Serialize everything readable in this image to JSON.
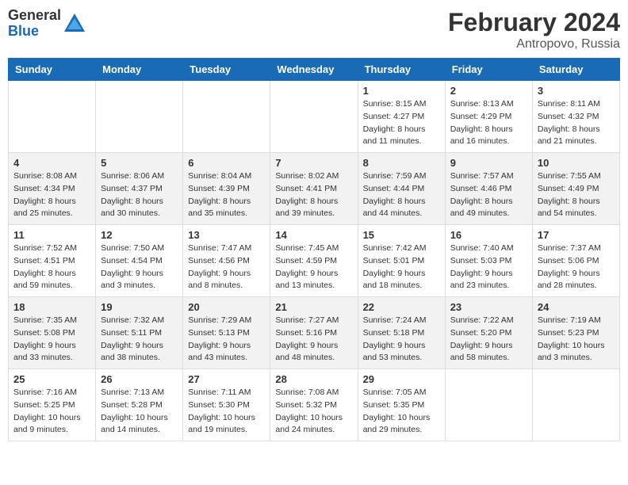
{
  "logo": {
    "general": "General",
    "blue": "Blue"
  },
  "header": {
    "month_year": "February 2024",
    "location": "Antropovo, Russia"
  },
  "days_of_week": [
    "Sunday",
    "Monday",
    "Tuesday",
    "Wednesday",
    "Thursday",
    "Friday",
    "Saturday"
  ],
  "weeks": [
    [
      {
        "day": "",
        "info": ""
      },
      {
        "day": "",
        "info": ""
      },
      {
        "day": "",
        "info": ""
      },
      {
        "day": "",
        "info": ""
      },
      {
        "day": "1",
        "info": "Sunrise: 8:15 AM\nSunset: 4:27 PM\nDaylight: 8 hours and 11 minutes."
      },
      {
        "day": "2",
        "info": "Sunrise: 8:13 AM\nSunset: 4:29 PM\nDaylight: 8 hours and 16 minutes."
      },
      {
        "day": "3",
        "info": "Sunrise: 8:11 AM\nSunset: 4:32 PM\nDaylight: 8 hours and 21 minutes."
      }
    ],
    [
      {
        "day": "4",
        "info": "Sunrise: 8:08 AM\nSunset: 4:34 PM\nDaylight: 8 hours and 25 minutes."
      },
      {
        "day": "5",
        "info": "Sunrise: 8:06 AM\nSunset: 4:37 PM\nDaylight: 8 hours and 30 minutes."
      },
      {
        "day": "6",
        "info": "Sunrise: 8:04 AM\nSunset: 4:39 PM\nDaylight: 8 hours and 35 minutes."
      },
      {
        "day": "7",
        "info": "Sunrise: 8:02 AM\nSunset: 4:41 PM\nDaylight: 8 hours and 39 minutes."
      },
      {
        "day": "8",
        "info": "Sunrise: 7:59 AM\nSunset: 4:44 PM\nDaylight: 8 hours and 44 minutes."
      },
      {
        "day": "9",
        "info": "Sunrise: 7:57 AM\nSunset: 4:46 PM\nDaylight: 8 hours and 49 minutes."
      },
      {
        "day": "10",
        "info": "Sunrise: 7:55 AM\nSunset: 4:49 PM\nDaylight: 8 hours and 54 minutes."
      }
    ],
    [
      {
        "day": "11",
        "info": "Sunrise: 7:52 AM\nSunset: 4:51 PM\nDaylight: 8 hours and 59 minutes."
      },
      {
        "day": "12",
        "info": "Sunrise: 7:50 AM\nSunset: 4:54 PM\nDaylight: 9 hours and 3 minutes."
      },
      {
        "day": "13",
        "info": "Sunrise: 7:47 AM\nSunset: 4:56 PM\nDaylight: 9 hours and 8 minutes."
      },
      {
        "day": "14",
        "info": "Sunrise: 7:45 AM\nSunset: 4:59 PM\nDaylight: 9 hours and 13 minutes."
      },
      {
        "day": "15",
        "info": "Sunrise: 7:42 AM\nSunset: 5:01 PM\nDaylight: 9 hours and 18 minutes."
      },
      {
        "day": "16",
        "info": "Sunrise: 7:40 AM\nSunset: 5:03 PM\nDaylight: 9 hours and 23 minutes."
      },
      {
        "day": "17",
        "info": "Sunrise: 7:37 AM\nSunset: 5:06 PM\nDaylight: 9 hours and 28 minutes."
      }
    ],
    [
      {
        "day": "18",
        "info": "Sunrise: 7:35 AM\nSunset: 5:08 PM\nDaylight: 9 hours and 33 minutes."
      },
      {
        "day": "19",
        "info": "Sunrise: 7:32 AM\nSunset: 5:11 PM\nDaylight: 9 hours and 38 minutes."
      },
      {
        "day": "20",
        "info": "Sunrise: 7:29 AM\nSunset: 5:13 PM\nDaylight: 9 hours and 43 minutes."
      },
      {
        "day": "21",
        "info": "Sunrise: 7:27 AM\nSunset: 5:16 PM\nDaylight: 9 hours and 48 minutes."
      },
      {
        "day": "22",
        "info": "Sunrise: 7:24 AM\nSunset: 5:18 PM\nDaylight: 9 hours and 53 minutes."
      },
      {
        "day": "23",
        "info": "Sunrise: 7:22 AM\nSunset: 5:20 PM\nDaylight: 9 hours and 58 minutes."
      },
      {
        "day": "24",
        "info": "Sunrise: 7:19 AM\nSunset: 5:23 PM\nDaylight: 10 hours and 3 minutes."
      }
    ],
    [
      {
        "day": "25",
        "info": "Sunrise: 7:16 AM\nSunset: 5:25 PM\nDaylight: 10 hours and 9 minutes."
      },
      {
        "day": "26",
        "info": "Sunrise: 7:13 AM\nSunset: 5:28 PM\nDaylight: 10 hours and 14 minutes."
      },
      {
        "day": "27",
        "info": "Sunrise: 7:11 AM\nSunset: 5:30 PM\nDaylight: 10 hours and 19 minutes."
      },
      {
        "day": "28",
        "info": "Sunrise: 7:08 AM\nSunset: 5:32 PM\nDaylight: 10 hours and 24 minutes."
      },
      {
        "day": "29",
        "info": "Sunrise: 7:05 AM\nSunset: 5:35 PM\nDaylight: 10 hours and 29 minutes."
      },
      {
        "day": "",
        "info": ""
      },
      {
        "day": "",
        "info": ""
      }
    ]
  ]
}
